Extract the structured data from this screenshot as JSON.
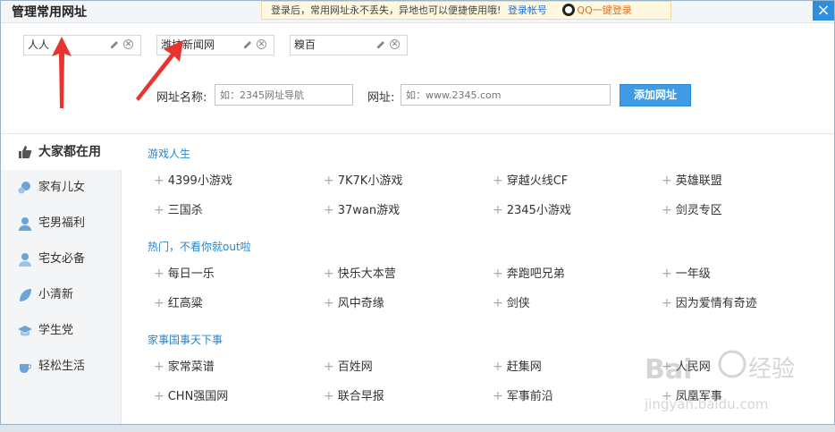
{
  "dialog": {
    "title": "管理常用网址",
    "notice_text": "登录后，常用网址永不丢失，异地也可以便捷使用哦!",
    "notice_link": "登录帐号",
    "qq_link": "QQ一键登录",
    "close_label": "×"
  },
  "chips": [
    {
      "label": "人人"
    },
    {
      "label": "潍坊新闻网"
    },
    {
      "label": "糗百"
    }
  ],
  "form": {
    "name_label": "网址名称:",
    "name_placeholder": "如：2345网址导航",
    "url_label": "网址:",
    "url_placeholder": "如：www.2345.com",
    "add_button": "添加网址"
  },
  "sidebar": {
    "items": [
      {
        "label": "大家都在用",
        "icon": "thumbs-up-icon",
        "active": true
      },
      {
        "label": "家有儿女",
        "icon": "family-icon"
      },
      {
        "label": "宅男福利",
        "icon": "man-icon"
      },
      {
        "label": "宅女必备",
        "icon": "woman-icon"
      },
      {
        "label": "小清新",
        "icon": "leaf-icon"
      },
      {
        "label": "学生党",
        "icon": "student-icon"
      },
      {
        "label": "轻松生活",
        "icon": "cup-icon"
      }
    ]
  },
  "sections": [
    {
      "title": "游戏人生",
      "links": [
        "4399小游戏",
        "7K7K小游戏",
        "穿越火线CF",
        "英雄联盟",
        "三国杀",
        "37wan游戏",
        "2345小游戏",
        "剑灵专区"
      ]
    },
    {
      "title": "热门，不看你就out啦",
      "links": [
        "每日一乐",
        "快乐大本营",
        "奔跑吧兄弟",
        "一年级",
        "红高粱",
        "风中奇缘",
        "剑侠",
        "因为爱情有奇迹"
      ]
    },
    {
      "title": "家事国事天下事",
      "links": [
        "家常菜谱",
        "百姓网",
        "赶集网",
        "人民网",
        "CHN强国网",
        "联合早报",
        "军事前沿",
        "凤凰军事"
      ]
    }
  ],
  "watermark": {
    "brand": "Bai",
    "brand_cn": "经验",
    "url": "jingyan.baidu.com"
  },
  "colors": {
    "accent": "#2f8fdd",
    "section_title": "#2a86c9",
    "arrow": "#e8332e"
  }
}
